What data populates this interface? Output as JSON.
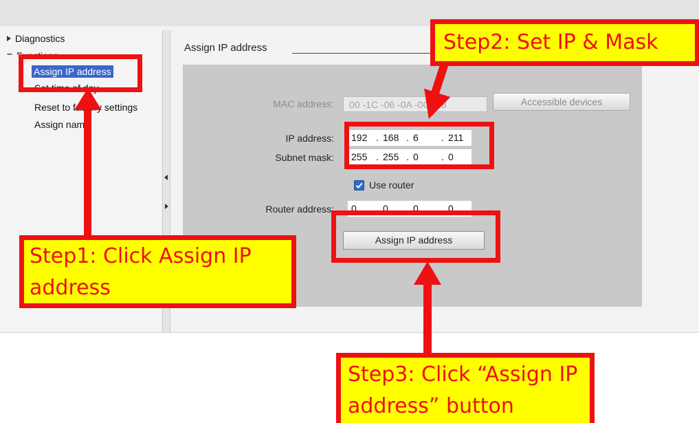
{
  "navigation": {
    "items": [
      {
        "label": "Diagnostics",
        "state": "collapsed"
      },
      {
        "label": "Functions",
        "state": "expanded"
      },
      {
        "label": "Assign IP address",
        "selected": true
      },
      {
        "label": "Set time of day"
      },
      {
        "label": "Reset to factory settings"
      },
      {
        "label": "Assign name"
      }
    ]
  },
  "section": {
    "title": "Assign IP address"
  },
  "form": {
    "mac": {
      "label": "MAC address:",
      "value": "00 -1C -06 -0A -0C -08"
    },
    "accessible_devices_label": "Accessible devices",
    "ip": {
      "label": "IP address:",
      "octets": [
        "192",
        "168",
        "6",
        "211"
      ]
    },
    "subnet": {
      "label": "Subnet mask:",
      "octets": [
        "255",
        "255",
        "0",
        "0"
      ]
    },
    "use_router": {
      "label": "Use router",
      "checked": true
    },
    "router": {
      "label": "Router address:",
      "octets": [
        "0",
        "0",
        "0",
        "0"
      ]
    },
    "assign_button_label": "Assign IP address"
  },
  "annotations": {
    "step1": "Step1: Click Assign IP address",
    "step2": "Step2: Set IP & Mask",
    "step3": "Step3: Click “Assign IP address” button"
  },
  "colors": {
    "highlight_red": "#ee1111",
    "callout_yellow": "#ffff00",
    "selection_blue": "#3a66cc",
    "checkbox_blue": "#2a6fc9"
  },
  "icons": [
    "expand-arrow-icon",
    "collapse-arrow-icon",
    "checkmark-icon",
    "splitter-arrow-icon"
  ]
}
